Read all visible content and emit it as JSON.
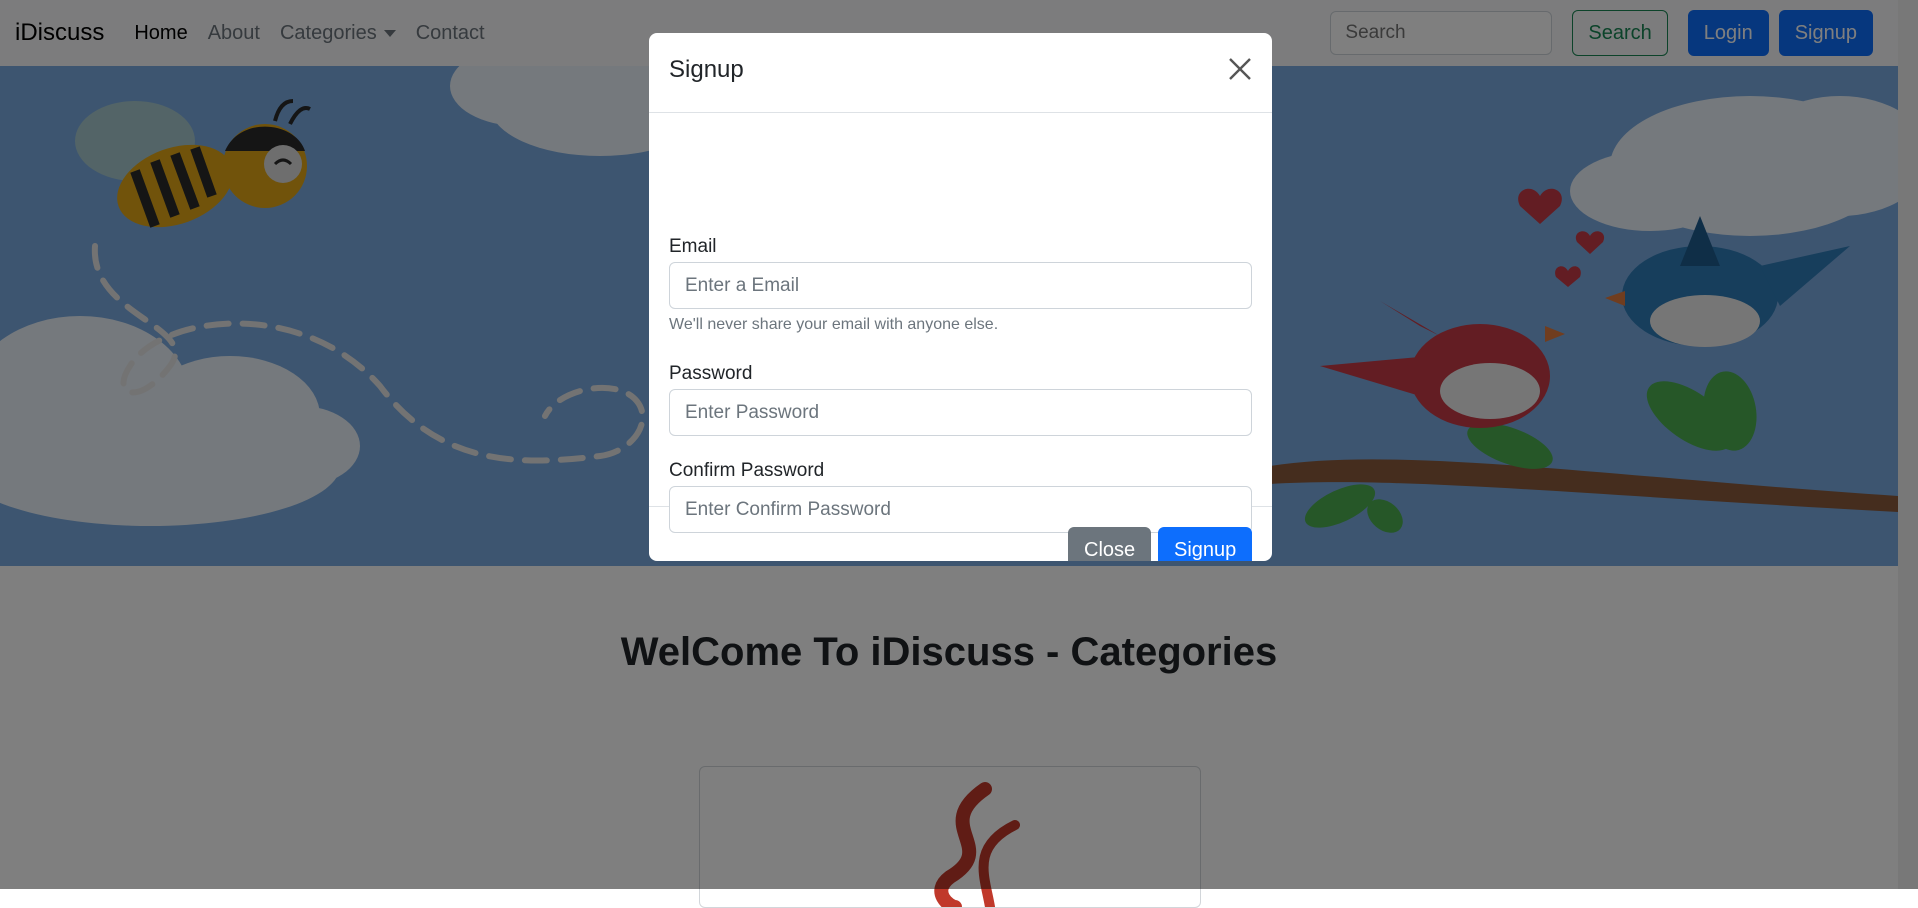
{
  "navbar": {
    "brand": "iDiscuss",
    "links": [
      "Home",
      "About",
      "Categories",
      "Contact"
    ],
    "search_placeholder": "Search",
    "search_button": "Search",
    "login_button": "Login",
    "signup_button": "Signup"
  },
  "main": {
    "heading": "WelCome To iDiscuss - Categories"
  },
  "modal": {
    "title": "Signup",
    "email_label": "Email",
    "email_placeholder": "Enter a Email",
    "email_help": "We'll never share your email with anyone else.",
    "password_label": "Password",
    "password_placeholder": "Enter Password",
    "confirm_label": "Confirm Password",
    "confirm_placeholder": "Enter Confirm Password",
    "close_button": "Close",
    "signup_button": "Signup"
  },
  "colors": {
    "primary": "#0d6efd",
    "success": "#198754",
    "secondary": "#6c757d",
    "hero_sky": "#7aabe1"
  }
}
